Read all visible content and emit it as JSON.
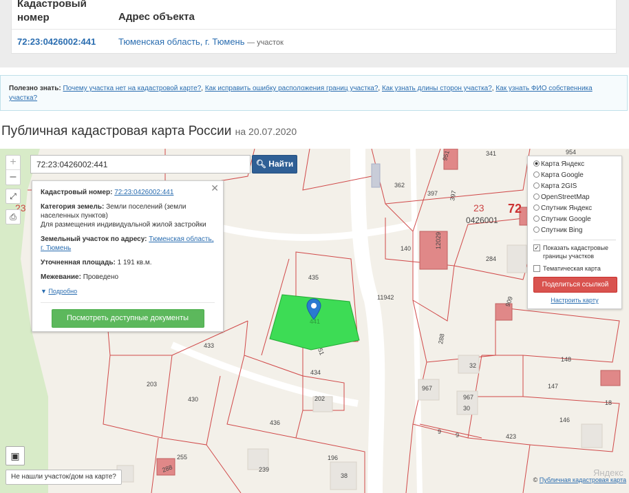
{
  "table": {
    "header_number": "Кадастровый номер",
    "header_address": "Адрес объекта",
    "cad_number": "72:23:0426002:441",
    "address_link": "Тюменская область, г. Тюмень",
    "address_suffix": "— участок"
  },
  "useful": {
    "label": "Полезно знать:",
    "links": [
      "Почему участка нет на кадастровой карте?",
      "Как исправить ошибку расположения границ участка?",
      "Как узнать длины сторон участка?",
      "Как узнать ФИО собственника участка?"
    ]
  },
  "heading": {
    "title": "Публичная кадастровая карта России",
    "date_text": "на 20.07.2020"
  },
  "map": {
    "controls": {
      "zoom_in": "+",
      "zoom_out": "–"
    },
    "search_value": "72:23:0426002:441",
    "search_button": "Найти",
    "info": {
      "cad_label": "Кадастровый номер:",
      "cad_value": "72:23:0426002:441",
      "category_label": "Категория земель:",
      "category_value": "Земли поселений (земли населенных пунктов)",
      "usage": "Для размещения индивидуальной жилой застройки",
      "address_label": "Земельный участок по адресу:",
      "address_value": "Тюменская область, г. Тюмень",
      "area_label": "Уточненная площадь:",
      "area_value": "1 191 кв.м.",
      "survey_label": "Межевание:",
      "survey_value": "Проведено",
      "more": "Подробно",
      "docs_button": "Посмотреть доступные документы"
    },
    "layers": {
      "options": [
        "Карта Яндекс",
        "Карта Google",
        "Карта 2GIS",
        "OpenStreetMap",
        "Спутник Яндекс",
        "Спутник Google",
        "Спутник Bing"
      ],
      "selected": 0,
      "show_borders": "Показать кадастровые границы участков",
      "show_borders_checked": true,
      "thematic": "Тематическая карта",
      "share_button": "Поделиться ссылкой",
      "tune_link": "Настроить карту"
    },
    "not_found_button": "Не нашли участок/дом на карте?",
    "copyright_link": "Публичная кадастровая карта",
    "watermark": "Яндекс",
    "parcel_labels": {
      "p951": "951",
      "p341": "341",
      "p954": "954",
      "p23a": "23",
      "p72": "72",
      "p362": "362",
      "p397": "397",
      "p397b": "397",
      "p23b": "23",
      "p0426001": "0426001",
      "p12029": "12029",
      "p140": "140",
      "p284": "284",
      "p435": "435",
      "p441": "441",
      "p11942": "11942",
      "p909": "909",
      "p288": "288",
      "p148": "148",
      "p433": "433",
      "p51": "51",
      "p32": "32",
      "p434": "434",
      "p147": "147",
      "p18": "18",
      "p203": "203",
      "p967a": "967",
      "p967b": "967",
      "p30": "30",
      "p430": "430",
      "p202": "202",
      "p146": "146",
      "p436": "436",
      "p9a": "9",
      "p9b": "9",
      "p423": "423",
      "p255": "255",
      "p196": "196",
      "p239": "239",
      "p38": "38",
      "p288b": "288"
    }
  }
}
